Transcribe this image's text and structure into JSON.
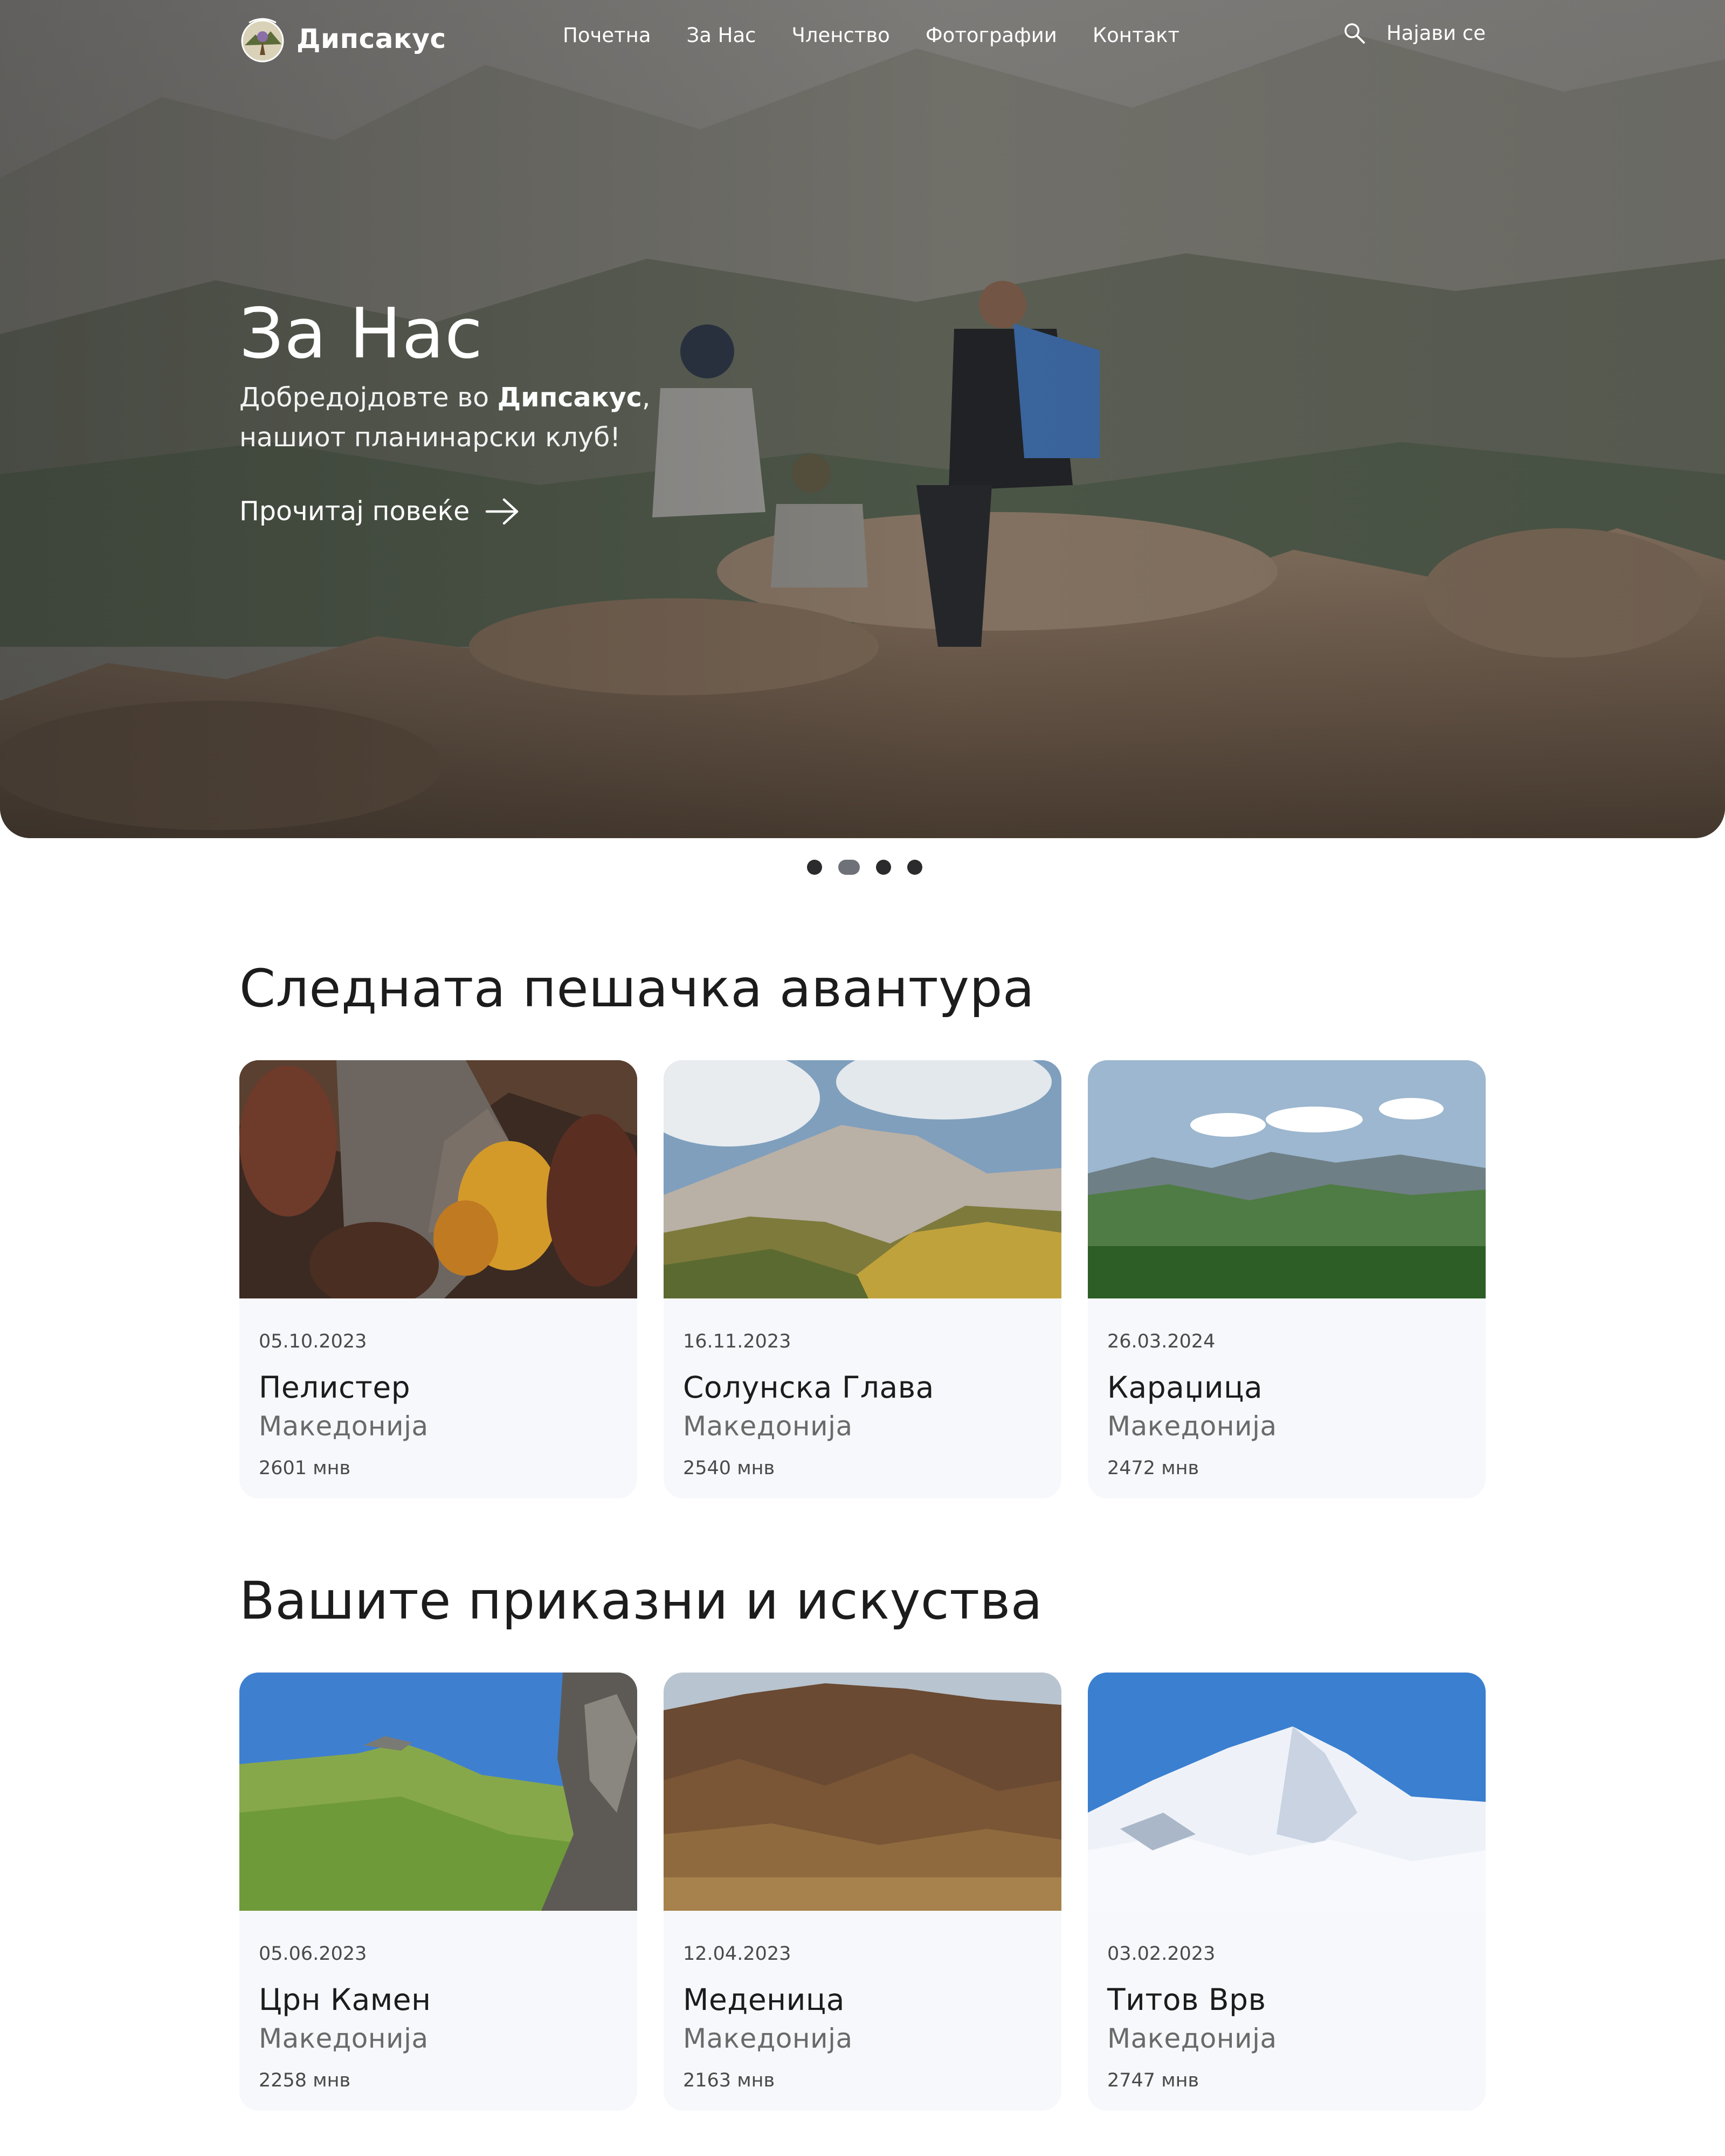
{
  "brand": {
    "name": "Дипсакус",
    "logo_icon": "dipsacus-logo"
  },
  "nav": {
    "links": [
      "Почетна",
      "За Нас",
      "Членство",
      "Фотографии",
      "Контакт"
    ],
    "search_icon": "search-icon",
    "login": "Најави се"
  },
  "hero": {
    "title": "За Нас",
    "subtitle_prefix": "Добредојдовте во ",
    "subtitle_brand": "Дипсакус",
    "subtitle_suffix": ",",
    "subtitle_line2": "нашиот планинарски клуб!",
    "cta": "Прочитај повеќе",
    "cta_icon": "arrow-right-icon",
    "slide_count": 4,
    "active_slide": 2
  },
  "upcoming": {
    "title": "Следната пешачка авантура",
    "cards": [
      {
        "date": "05.10.2023",
        "name": "Пелистер",
        "country": "Македонија",
        "elevation": "2601 мнв"
      },
      {
        "date": "16.11.2023",
        "name": "Солунска Глава",
        "country": "Македонија",
        "elevation": "2540 мнв"
      },
      {
        "date": "26.03.2024",
        "name": "Караџица",
        "country": "Македонија",
        "elevation": "2472 мнв"
      }
    ]
  },
  "stories": {
    "title": "Вашите приказни и искуства",
    "cards": [
      {
        "date": "05.06.2023",
        "name": "Црн Камен",
        "country": "Македонија",
        "elevation": "2258 мнв"
      },
      {
        "date": "12.04.2023",
        "name": "Меденица",
        "country": "Македонија",
        "elevation": "2163 мнв"
      },
      {
        "date": "03.02.2023",
        "name": "Титов Врв",
        "country": "Македонија",
        "elevation": "2747 мнв"
      }
    ]
  },
  "colors": {
    "card_bg": "#f7f8fc",
    "text_dark": "#1c1c1c",
    "text_muted": "#6a6a6a"
  }
}
